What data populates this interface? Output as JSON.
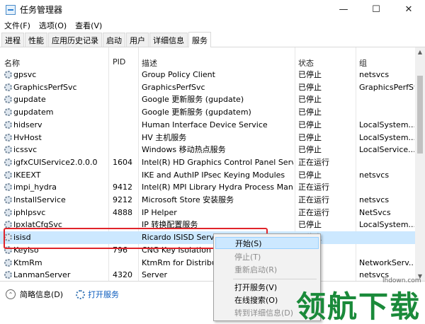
{
  "window": {
    "title": "任务管理器",
    "minimize": "—",
    "maximize": "☐",
    "close": "✕"
  },
  "menu": [
    "文件(F)",
    "选项(O)",
    "查看(V)"
  ],
  "tabs": [
    {
      "label": "进程",
      "active": false
    },
    {
      "label": "性能",
      "active": false
    },
    {
      "label": "应用历史记录",
      "active": false
    },
    {
      "label": "启动",
      "active": false
    },
    {
      "label": "用户",
      "active": false
    },
    {
      "label": "详细信息",
      "active": false
    },
    {
      "label": "服务",
      "active": true
    }
  ],
  "table": {
    "columns": {
      "name": "名称",
      "pid": "PID",
      "desc": "描述",
      "status": "状态",
      "group": "组"
    },
    "rows": [
      {
        "name": "gpsvc",
        "pid": "",
        "desc": "Group Policy Client",
        "status": "已停止",
        "group": "netsvcs"
      },
      {
        "name": "GraphicsPerfSvc",
        "pid": "",
        "desc": "GraphicsPerfSvc",
        "status": "已停止",
        "group": "GraphicsPerfSvc"
      },
      {
        "name": "gupdate",
        "pid": "",
        "desc": "Google 更新服务 (gupdate)",
        "status": "已停止",
        "group": ""
      },
      {
        "name": "gupdatem",
        "pid": "",
        "desc": "Google 更新服务 (gupdatem)",
        "status": "已停止",
        "group": ""
      },
      {
        "name": "hidserv",
        "pid": "",
        "desc": "Human Interface Device Service",
        "status": "已停止",
        "group": "LocalSystem..."
      },
      {
        "name": "HvHost",
        "pid": "",
        "desc": "HV 主机服务",
        "status": "已停止",
        "group": "LocalSystem..."
      },
      {
        "name": "icssvc",
        "pid": "",
        "desc": "Windows 移动热点服务",
        "status": "已停止",
        "group": "LocalService..."
      },
      {
        "name": "igfxCUIService2.0.0.0",
        "pid": "1604",
        "desc": "Intel(R) HD Graphics Control Panel Service",
        "status": "正在运行",
        "group": ""
      },
      {
        "name": "IKEEXT",
        "pid": "",
        "desc": "IKE and AuthIP IPsec Keying Modules",
        "status": "已停止",
        "group": "netsvcs"
      },
      {
        "name": "impi_hydra",
        "pid": "9412",
        "desc": "Intel(R) MPI Library Hydra Process Mana...",
        "status": "正在运行",
        "group": ""
      },
      {
        "name": "InstallService",
        "pid": "9212",
        "desc": "Microsoft Store 安装服务",
        "status": "正在运行",
        "group": "netsvcs"
      },
      {
        "name": "iphlpsvc",
        "pid": "4888",
        "desc": "IP Helper",
        "status": "正在运行",
        "group": "NetSvcs"
      },
      {
        "name": "IpxlatCfgSvc",
        "pid": "",
        "desc": "IP 转换配置服务",
        "status": "已停止",
        "group": "LocalSystem..."
      },
      {
        "name": "isisd",
        "pid": "",
        "desc": "Ricardo ISISD Servic",
        "status": "已停止",
        "group": "",
        "selected": true
      },
      {
        "name": "KeyIso",
        "pid": "796",
        "desc": "CNG Key Isolation",
        "status": "",
        "group": ""
      },
      {
        "name": "KtmRm",
        "pid": "",
        "desc": "KtmRm for Distribute",
        "status": "",
        "group": "NetworkServ..."
      },
      {
        "name": "LanmanServer",
        "pid": "4320",
        "desc": "Server",
        "status": "",
        "group": "netsvcs"
      }
    ]
  },
  "footer": {
    "details_label": "简略信息(D)",
    "open_services": "打开服务"
  },
  "context_menu": {
    "items": [
      {
        "label": "开始(S)",
        "highlighted": true,
        "disabled": false
      },
      {
        "label": "停止(T)",
        "highlighted": false,
        "disabled": true
      },
      {
        "label": "重新启动(R)",
        "highlighted": false,
        "disabled": true
      },
      {
        "label": "打开服务(V)",
        "highlighted": false,
        "disabled": false
      },
      {
        "label": "在线搜索(O)",
        "highlighted": false,
        "disabled": false
      },
      {
        "label": "转到详细信息(D)",
        "highlighted": false,
        "disabled": true
      }
    ]
  },
  "watermark": {
    "brand": "领航下载",
    "url": "lhdown.com"
  },
  "colors": {
    "selection": "#cce8ff",
    "highlight_box": "#e0242a",
    "link": "#0a5bbd",
    "watermark": "#1a8a3a"
  }
}
